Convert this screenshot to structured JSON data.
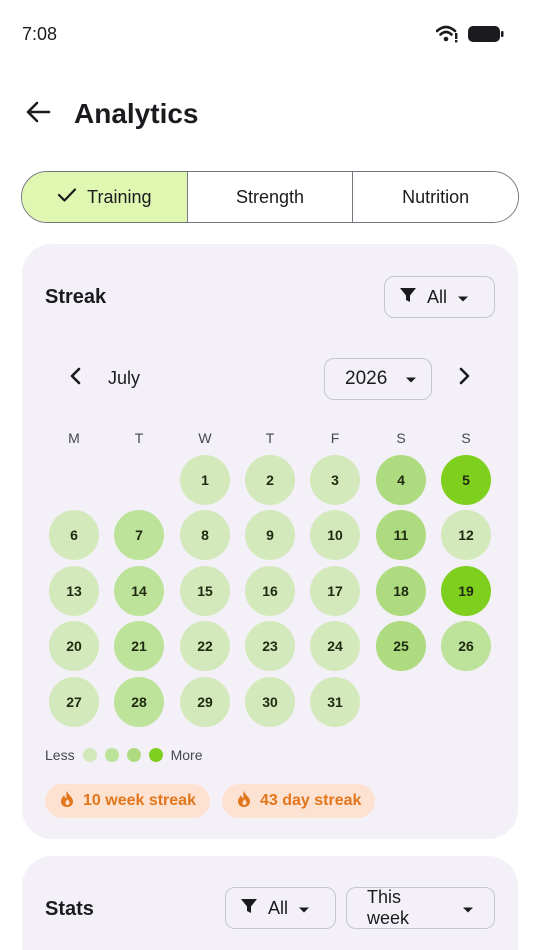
{
  "status": {
    "time": "7:08",
    "icons": [
      "wifi-icon",
      "battery-icon"
    ]
  },
  "app_bar": {
    "title": "Analytics",
    "back_icon": "arrow-left-icon"
  },
  "tabs": [
    {
      "label": "Training",
      "selected": true
    },
    {
      "label": "Strength",
      "selected": false
    },
    {
      "label": "Nutrition",
      "selected": false
    }
  ],
  "streak_card": {
    "title": "Streak",
    "filter_label": "All",
    "month": "July",
    "year": "2026",
    "weekdays": [
      "M",
      "T",
      "W",
      "T",
      "F",
      "S",
      "S"
    ],
    "first_weekday_index": 2,
    "days": [
      {
        "day": "1",
        "level": 1
      },
      {
        "day": "2",
        "level": 1
      },
      {
        "day": "3",
        "level": 1
      },
      {
        "day": "4",
        "level": 3
      },
      {
        "day": "5",
        "level": 4
      },
      {
        "day": "6",
        "level": 1
      },
      {
        "day": "7",
        "level": 2
      },
      {
        "day": "8",
        "level": 1
      },
      {
        "day": "9",
        "level": 1
      },
      {
        "day": "10",
        "level": 1
      },
      {
        "day": "11",
        "level": 3
      },
      {
        "day": "12",
        "level": 1
      },
      {
        "day": "13",
        "level": 1
      },
      {
        "day": "14",
        "level": 2
      },
      {
        "day": "15",
        "level": 1
      },
      {
        "day": "16",
        "level": 1
      },
      {
        "day": "17",
        "level": 1
      },
      {
        "day": "18",
        "level": 3
      },
      {
        "day": "19",
        "level": 4
      },
      {
        "day": "20",
        "level": 1
      },
      {
        "day": "21",
        "level": 2
      },
      {
        "day": "22",
        "level": 1
      },
      {
        "day": "23",
        "level": 1
      },
      {
        "day": "24",
        "level": 1
      },
      {
        "day": "25",
        "level": 3
      },
      {
        "day": "26",
        "level": 2
      },
      {
        "day": "27",
        "level": 1
      },
      {
        "day": "28",
        "level": 2
      },
      {
        "day": "29",
        "level": 1
      },
      {
        "day": "30",
        "level": 1
      },
      {
        "day": "31",
        "level": 1
      }
    ],
    "legend": {
      "less_label": "Less",
      "more_label": "More",
      "colors": [
        "#d4e9bb",
        "#bde29a",
        "#aedb7f",
        "#7fcf1e"
      ]
    },
    "chips": [
      {
        "label": "10 week streak",
        "icon": "fire-icon"
      },
      {
        "label": "43 day streak",
        "icon": "fire-icon"
      }
    ]
  },
  "stats_card": {
    "title": "Stats",
    "filter_label": "All",
    "period_label": "This week"
  },
  "colors": {
    "accent_selected": "#dff7b0",
    "card_bg": "#f4f0f8",
    "chip_bg": "#fde2d2",
    "chip_text": "#e2761d"
  }
}
